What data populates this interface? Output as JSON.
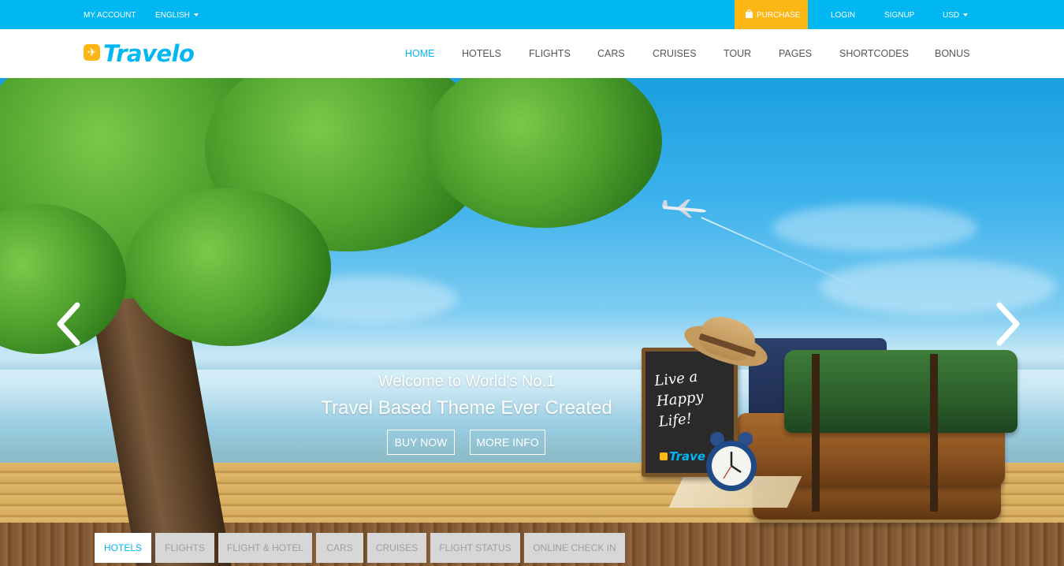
{
  "topbar": {
    "my_account": "MY ACCOUNT",
    "language": "ENGLISH",
    "purchase": "PURCHASE",
    "login": "LOGIN",
    "signup": "SIGNUP",
    "currency": "USD"
  },
  "brand": {
    "name": "Travelo",
    "primary_color": "#01b7f2",
    "accent_color": "#fdb714"
  },
  "nav": {
    "items": [
      {
        "label": "HOME",
        "active": true
      },
      {
        "label": "HOTELS"
      },
      {
        "label": "FLIGHTS"
      },
      {
        "label": "CARS"
      },
      {
        "label": "CRUISES"
      },
      {
        "label": "TOUR"
      },
      {
        "label": "PAGES"
      },
      {
        "label": "SHORTCODES"
      },
      {
        "label": "BONUS"
      }
    ]
  },
  "hero": {
    "line1": "Welcome to World's No.1",
    "line2": "Travel Based Theme Ever Created",
    "buy_now": "BUY NOW",
    "more_info": "MORE INFO",
    "chalkboard_line1": "Live a",
    "chalkboard_line2": "Happy",
    "chalkboard_line3": "Life!",
    "chalkboard_logo": "Trave"
  },
  "search_tabs": [
    {
      "label": "HOTELS",
      "active": true
    },
    {
      "label": "FLIGHTS"
    },
    {
      "label": "FLIGHT & HOTEL"
    },
    {
      "label": "CARS"
    },
    {
      "label": "CRUISES"
    },
    {
      "label": "FLIGHT STATUS"
    },
    {
      "label": "ONLINE CHECK IN"
    }
  ]
}
